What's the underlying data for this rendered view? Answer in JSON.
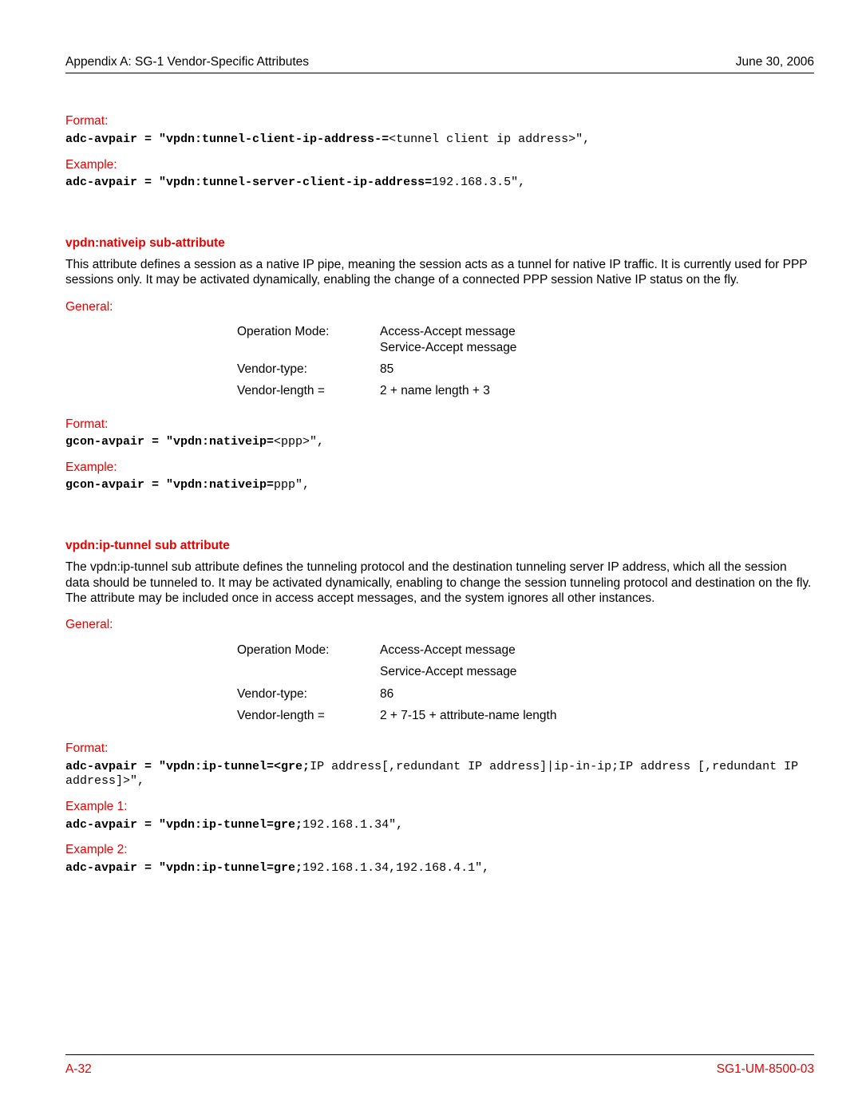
{
  "header": {
    "left": "Appendix A: SG-1 Vendor-Specific Attributes",
    "right": "June 30, 2006"
  },
  "block1": {
    "format_label": "Format:",
    "format_code_bold": "adc-avpair = \"vpdn:tunnel-client-ip-address-=",
    "format_code_plain": "<tunnel client ip address>\",",
    "example_label": "Example:",
    "example_code_bold": "adc-avpair = \"vpdn:tunnel-server-client-ip-address=",
    "example_code_plain": "192.168.3.5\","
  },
  "section2": {
    "heading": "vpdn:nativeip sub-attribute",
    "para": "This attribute defines a session as a native IP pipe, meaning the session acts as a tunnel for native IP traffic. It is currently used for PPP sessions only. It may be activated dynamically, enabling the change of a connected PPP session Native IP status on the fly.",
    "general_label": "General:",
    "table": {
      "row1_label": "Operation Mode:",
      "row1_val1": "Access-Accept message",
      "row1_val2": "Service-Accept message",
      "row2_label": "Vendor-type:",
      "row2_val": "85",
      "row3_label": "Vendor-length =",
      "row3_val": "2 + name length + 3"
    },
    "format_label": "Format:",
    "format_code_bold": "gcon-avpair = \"vpdn:nativeip=",
    "format_code_plain": "<ppp>\",",
    "example_label": "Example:",
    "example_code_bold": "gcon-avpair = \"vpdn:nativeip=",
    "example_code_plain": "ppp\","
  },
  "section3": {
    "heading": "vpdn:ip-tunnel sub attribute",
    "para": "The vpdn:ip-tunnel sub attribute defines the tunneling protocol and the destination tunneling server IP address, which all the session data should be tunneled to. It may be activated dynamically, enabling to change the session tunneling protocol and destination on the fly. The attribute may be included once in access accept messages, and the system ignores all other instances.",
    "general_label": "General:",
    "table": {
      "row1_label": "Operation Mode:",
      "row1_val1": "Access-Accept message",
      "row1_val2": "Service-Accept message",
      "row2_label": "Vendor-type:",
      "row2_val": "86",
      "row3_label": "Vendor-length =",
      "row3_val": "2 + 7-15 + attribute-name length"
    },
    "format_label": "Format:",
    "format_code_bold": "adc-avpair = \"vpdn:ip-tunnel=<gre;",
    "format_code_plain": "IP address[,redundant IP address]|ip-in-ip;IP address [,redundant IP address]>\",",
    "example1_label": "Example 1:",
    "example1_code_bold": "adc-avpair = \"vpdn:ip-tunnel=gre;",
    "example1_code_plain": "192.168.1.34\",",
    "example2_label": "Example 2:",
    "example2_code_bold": "adc-avpair = \"vpdn:ip-tunnel=gre;",
    "example2_code_plain": "192.168.1.34,192.168.4.1\","
  },
  "footer": {
    "left": "A-32",
    "right": "SG1-UM-8500-03"
  }
}
